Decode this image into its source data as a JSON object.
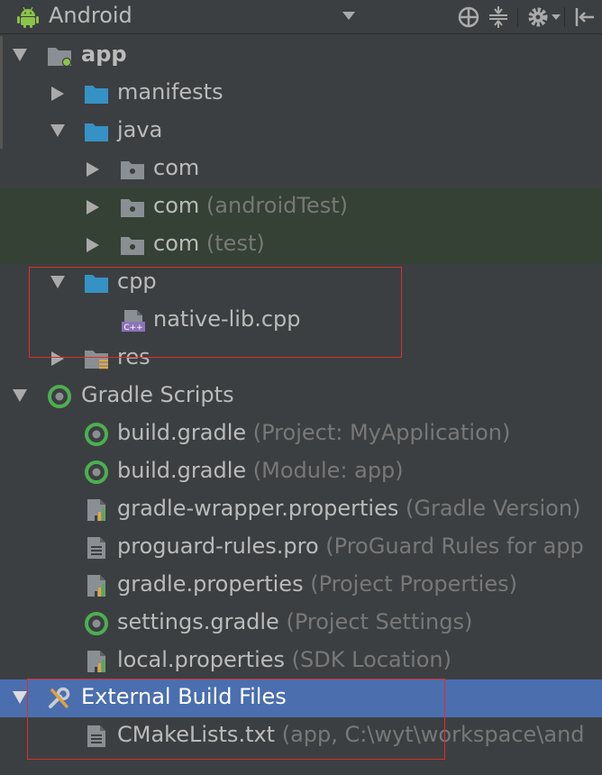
{
  "toolbar": {
    "view_label": "Android"
  },
  "tree": {
    "app": "app",
    "manifests": "manifests",
    "java": "java",
    "com1": "com",
    "com2": "com",
    "com2_hint": "(androidTest)",
    "com3": "com",
    "com3_hint": "(test)",
    "cpp": "cpp",
    "native_lib": "native-lib.cpp",
    "cpp_icon_text": "C++",
    "res": "res",
    "gradle_scripts": "Gradle Scripts",
    "files": [
      {
        "name": "build.gradle",
        "hint": "(Project: MyApplication)"
      },
      {
        "name": "build.gradle",
        "hint": "(Module: app)"
      },
      {
        "name": "gradle-wrapper.properties",
        "hint": "(Gradle Version)"
      },
      {
        "name": "proguard-rules.pro",
        "hint": "(ProGuard Rules for app"
      },
      {
        "name": "gradle.properties",
        "hint": "(Project Properties)"
      },
      {
        "name": "settings.gradle",
        "hint": "(Project Settings)"
      },
      {
        "name": "local.properties",
        "hint": "(SDK Location)"
      }
    ],
    "external_build_files": "External Build Files",
    "cmakelists": "CMakeLists.txt",
    "cmakelists_hint": "(app, C:\\wyt\\workspace\\and"
  },
  "colors": {
    "background": "#3c3f41",
    "selection": "#4b6eaf",
    "folder": "#3592c4",
    "highlight_box": "#d9302c",
    "test_tint": "#344134"
  }
}
